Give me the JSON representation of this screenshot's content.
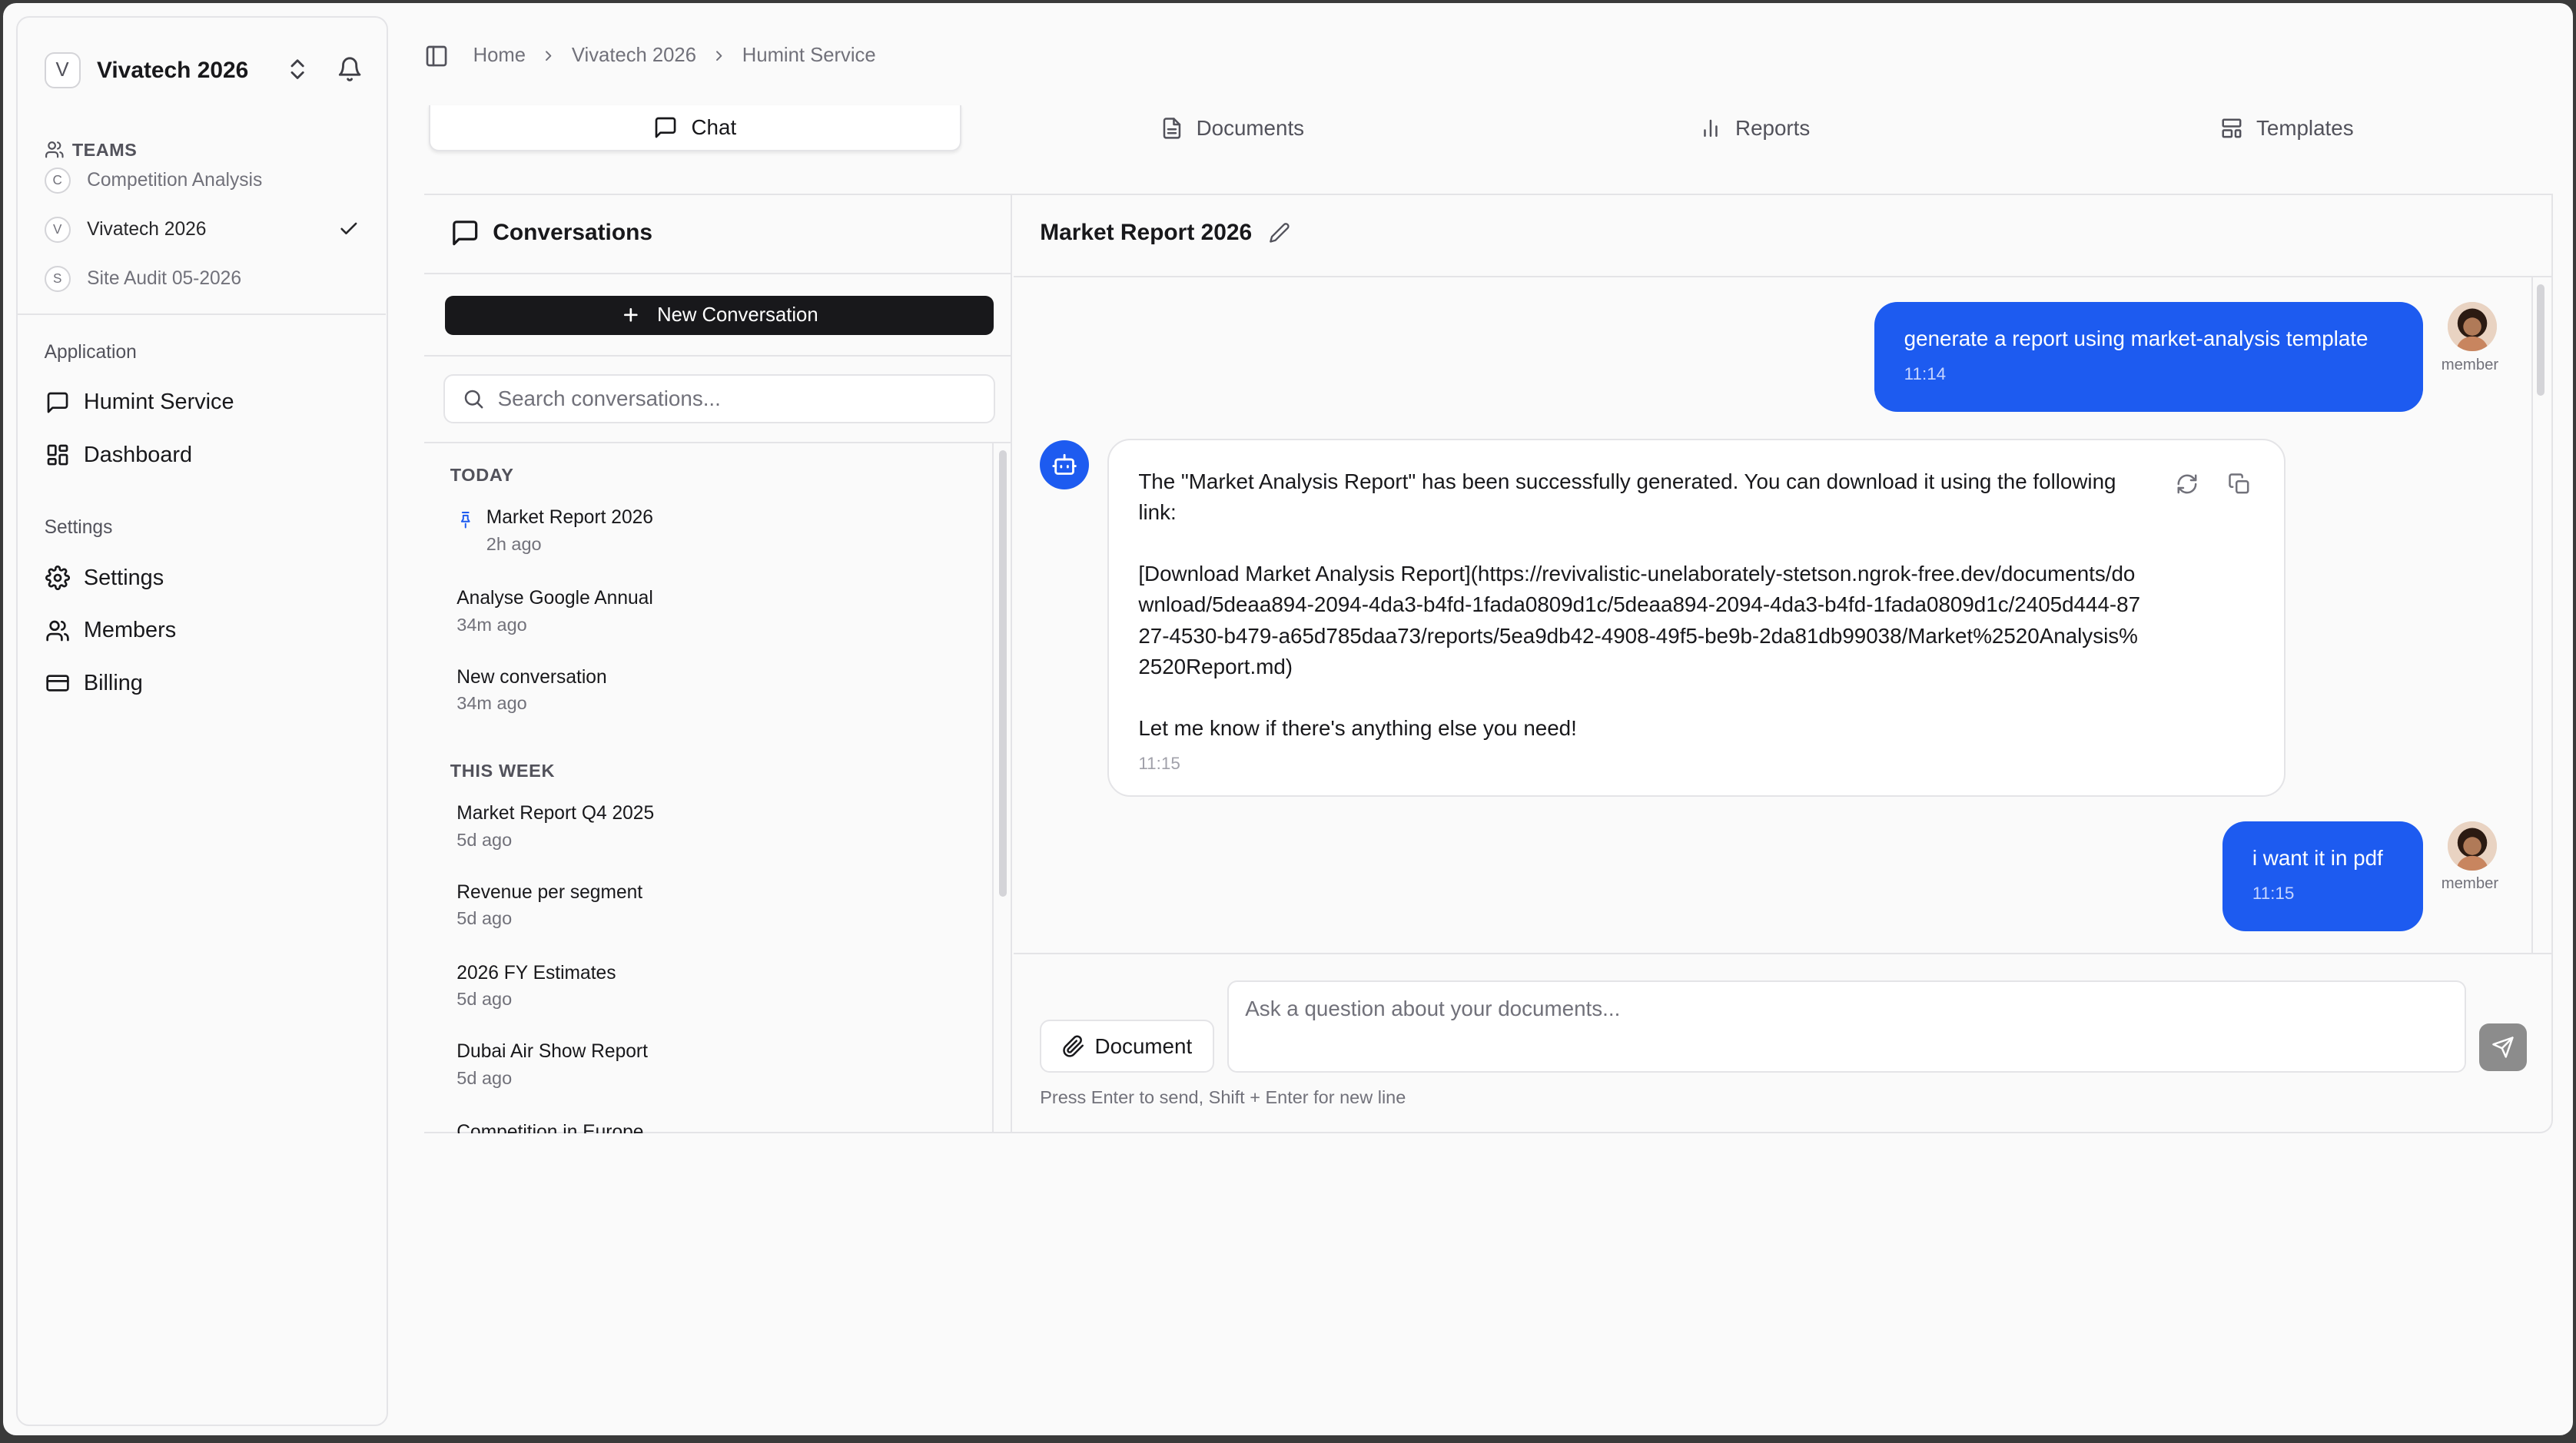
{
  "workspace": {
    "badge": "V",
    "name": "Vivatech 2026"
  },
  "teams": {
    "label": "TEAMS",
    "items": [
      {
        "badge": "C",
        "name": "Competition Analysis"
      },
      {
        "badge": "V",
        "name": "Vivatech 2026",
        "active": true
      },
      {
        "badge": "S",
        "name": "Site Audit 05-2026"
      }
    ]
  },
  "sidebar": {
    "application_label": "Application",
    "application_items": [
      {
        "label": "Humint Service",
        "icon": "message-square-icon"
      },
      {
        "label": "Dashboard",
        "icon": "layout-grid-icon"
      }
    ],
    "settings_label": "Settings",
    "settings_items": [
      {
        "label": "Settings",
        "icon": "gear-icon"
      },
      {
        "label": "Members",
        "icon": "users-icon"
      },
      {
        "label": "Billing",
        "icon": "credit-card-icon"
      }
    ]
  },
  "breadcrumb": [
    "Home",
    "Vivatech 2026",
    "Humint Service"
  ],
  "tabs": [
    {
      "label": "Chat",
      "icon": "message-square-icon",
      "active": true
    },
    {
      "label": "Documents",
      "icon": "file-text-icon"
    },
    {
      "label": "Reports",
      "icon": "bar-chart-icon"
    },
    {
      "label": "Templates",
      "icon": "layout-template-icon"
    }
  ],
  "conversations": {
    "title": "Conversations",
    "new_button": "New Conversation",
    "search_placeholder": "Search conversations...",
    "groups": [
      {
        "label": "TODAY",
        "items": [
          {
            "title": "Market Report 2026",
            "time": "2h ago",
            "pinned": true
          },
          {
            "title": "Analyse Google Annual",
            "time": "34m ago"
          },
          {
            "title": "New conversation",
            "time": "34m ago"
          }
        ]
      },
      {
        "label": "THIS WEEK",
        "items": [
          {
            "title": "Market Report Q4 2025",
            "time": "5d ago"
          },
          {
            "title": "Revenue per segment",
            "time": "5d ago"
          },
          {
            "title": "2026 FY Estimates",
            "time": "5d ago"
          },
          {
            "title": "Dubai Air Show Report",
            "time": "5d ago"
          },
          {
            "title": "Competition in Europe",
            "time": ""
          }
        ]
      }
    ]
  },
  "chat": {
    "title": "Market Report 2026",
    "messages": [
      {
        "role": "user",
        "text": "generate a report using market-analysis template",
        "time": "11:14",
        "author": "member"
      },
      {
        "role": "assistant",
        "paragraphs": [
          "The \"Market Analysis Report\" has been successfully generated. You can download it using the following link:",
          "[Download Market Analysis Report](https://revivalistic-unelaborately-stetson.ngrok-free.dev/documents/download/5deaa894-2094-4da3-b4fd-1fada0809d1c/5deaa894-2094-4da3-b4fd-1fada0809d1c/2405d444-8727-4530-b479-a65d785daa73/reports/5ea9db42-4908-49f5-be9b-2da81db99038/Market%2520Analysis%2520Report.md)",
          "Let me know if there's anything else you need!"
        ],
        "time": "11:15"
      },
      {
        "role": "user",
        "text": "i want it in pdf",
        "time": "11:15",
        "author": "member"
      }
    ],
    "document_button": "Document",
    "input_placeholder": "Ask a question about your documents...",
    "hint": "Press Enter to send, Shift + Enter for new line"
  },
  "colors": {
    "accent": "#1d5bf0",
    "dark_button": "#18181b",
    "send_button": "#8c8c8c"
  }
}
